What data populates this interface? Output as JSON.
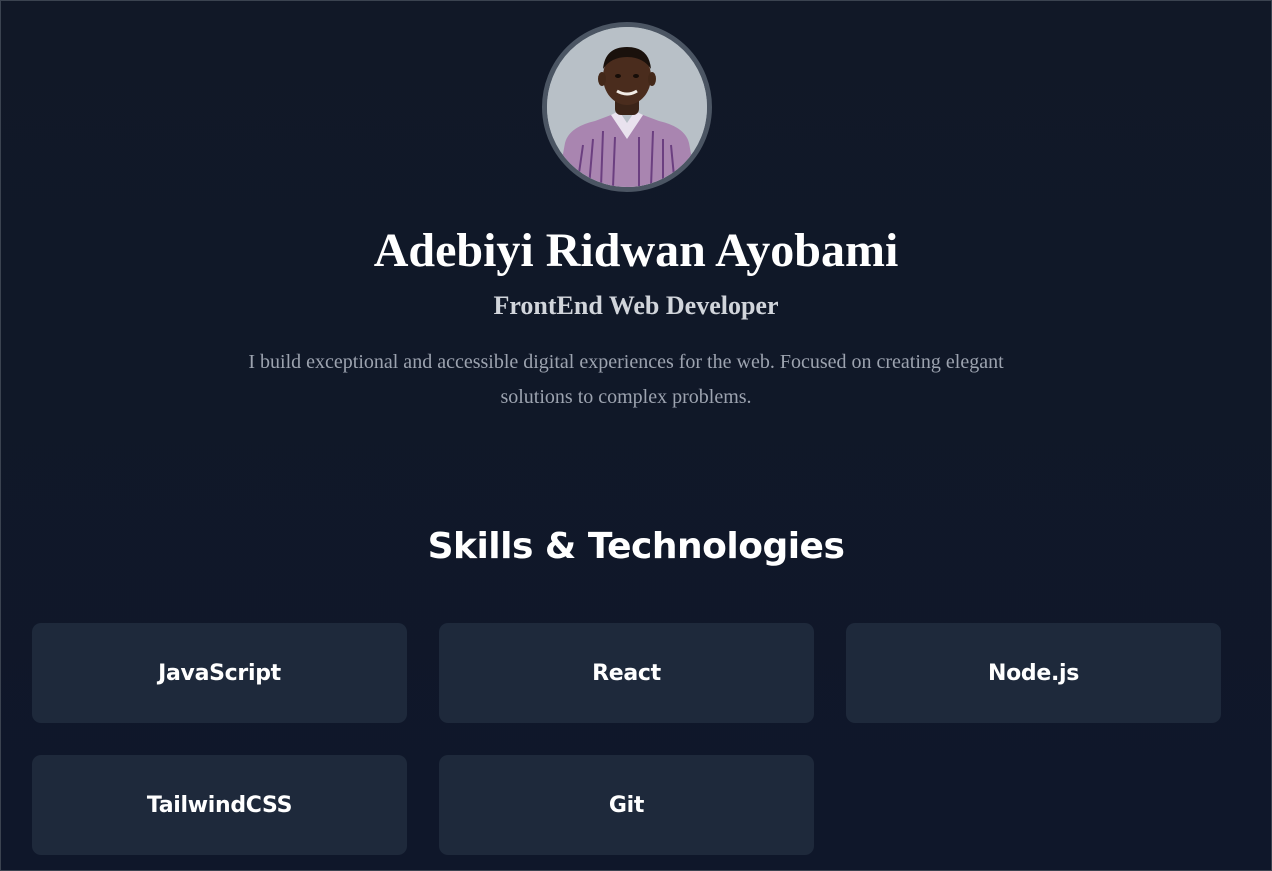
{
  "profile": {
    "avatar_icon": "profile-photo",
    "name": "Adebiyi Ridwan Ayobami",
    "role": "FrontEnd Web Developer",
    "bio": "I build exceptional and accessible digital experiences for the web. Focused on creating elegant solutions to complex problems."
  },
  "skills": {
    "title": "Skills & Technologies",
    "items": [
      {
        "label": "JavaScript"
      },
      {
        "label": "React"
      },
      {
        "label": "Node.js"
      },
      {
        "label": "TailwindCSS"
      },
      {
        "label": "Git"
      }
    ]
  },
  "colors": {
    "background": "#0f172a",
    "card": "#1e293b",
    "avatar_border": "#4b5563",
    "text_primary": "#ffffff",
    "text_secondary": "#d1d5db",
    "text_muted": "#9ca3af"
  }
}
